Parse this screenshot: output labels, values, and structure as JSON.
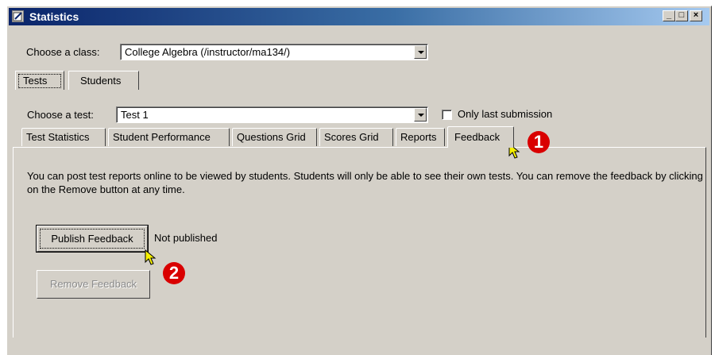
{
  "window": {
    "title": "Statistics"
  },
  "caption_buttons": {
    "minimize": "_",
    "maximize": "□",
    "close": "×"
  },
  "class_row": {
    "label": "Choose a class:",
    "value": "College Algebra (/instructor/ma134/)"
  },
  "top_tabs": [
    {
      "label": "Tests"
    },
    {
      "label": "Students"
    }
  ],
  "test_row": {
    "label": "Choose a test:",
    "value": "Test 1",
    "only_last_label": "Only last submission",
    "only_last_checked": false
  },
  "sub_tabs": [
    {
      "label": "Test Statistics"
    },
    {
      "label": "Student Performance"
    },
    {
      "label": "Questions Grid"
    },
    {
      "label": "Scores Grid"
    },
    {
      "label": "Reports"
    },
    {
      "label": "Feedback"
    }
  ],
  "feedback": {
    "description": "You can post test reports online to be viewed by students.  Students will only be able to see their own tests.  You can remove the feedback by clicking on the Remove button at any time.",
    "publish_label": "Publish Feedback",
    "status": "Not published",
    "remove_label": "Remove Feedback"
  },
  "callouts": {
    "one": "1",
    "two": "2"
  },
  "colors": {
    "badge": "#d90000",
    "title_bar": "#0a246a"
  }
}
